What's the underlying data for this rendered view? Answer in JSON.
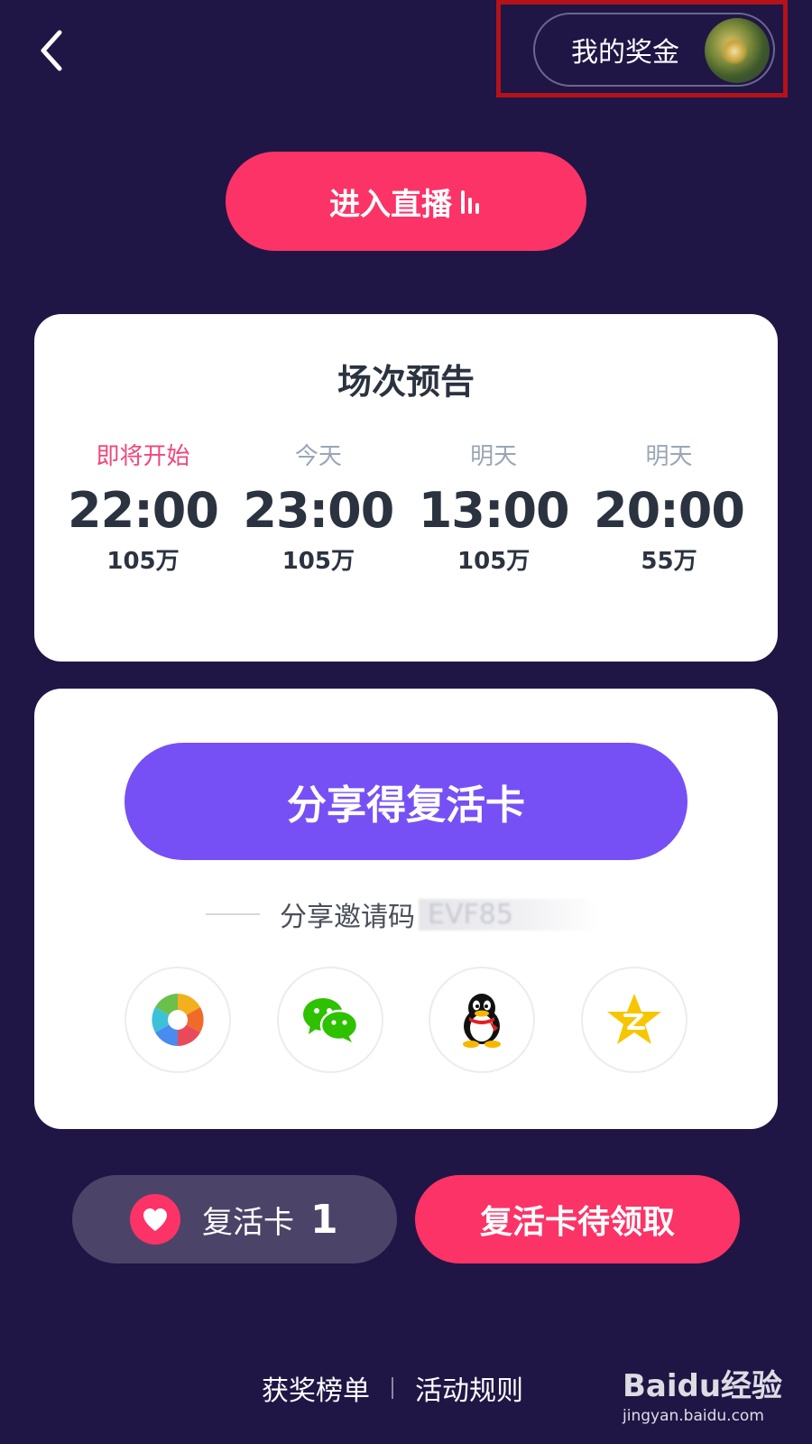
{
  "header": {
    "my_prize_label": "我的奖金"
  },
  "live": {
    "enter_label": "进入直播"
  },
  "schedule": {
    "title": "场次预告",
    "sessions": [
      {
        "day": "即将开始",
        "time": "22:00",
        "amount": "105万",
        "active": true
      },
      {
        "day": "今天",
        "time": "23:00",
        "amount": "105万",
        "active": false
      },
      {
        "day": "明天",
        "time": "13:00",
        "amount": "105万",
        "active": false
      },
      {
        "day": "明天",
        "time": "20:00",
        "amount": "55万",
        "active": false
      }
    ]
  },
  "share": {
    "button_label": "分享得复活卡",
    "invite_label": "分享邀请码",
    "invite_code": "EVF85",
    "targets": [
      "moments-icon",
      "wechat-icon",
      "qq-icon",
      "qzone-icon"
    ]
  },
  "revive": {
    "label": "复活卡",
    "count": "1",
    "claim_label": "复活卡待领取"
  },
  "footer": {
    "leaderboard_label": "获奖榜单",
    "rules_label": "活动规则"
  },
  "watermark": {
    "brand": "Baidu经验",
    "url": "jingyan.baidu.com"
  },
  "colors": {
    "background": "#1f1645",
    "accent_pink": "#fc3366",
    "accent_purple": "#7650f5",
    "highlight_red": "#b3121a"
  }
}
